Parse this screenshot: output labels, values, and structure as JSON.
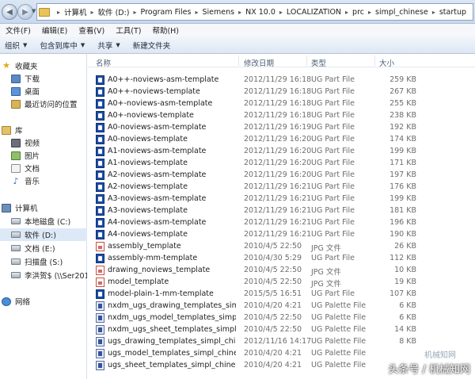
{
  "address": {
    "crumbs": [
      "计算机",
      "软件 (D:)",
      "Program Files",
      "Siemens",
      "NX 10.0",
      "LOCALIZATION",
      "prc",
      "simpl_chinese",
      "startup"
    ]
  },
  "menu": [
    "文件(F)",
    "编辑(E)",
    "查看(V)",
    "工具(T)",
    "帮助(H)"
  ],
  "commands": {
    "organize": "组织",
    "include": "包含到库中",
    "share": "共享",
    "new_folder": "新建文件夹"
  },
  "nav": {
    "favorites": "收藏夹",
    "downloads": "下载",
    "desktop": "桌面",
    "recent": "最近访问的位置",
    "libraries": "库",
    "videos": "视频",
    "pictures": "图片",
    "documents": "文档",
    "music": "音乐",
    "computer": "计算机",
    "drive_c": "本地磁盘 (C:)",
    "drive_d": "软件 (D:)",
    "drive_e": "文档 (E:)",
    "drive_s": "扫描盘 (S:)",
    "drive_net": "李洪贺$ (\\\\Ser2012",
    "network": "网络"
  },
  "columns": {
    "name": "名称",
    "date": "修改日期",
    "type": "类型",
    "size": "大小"
  },
  "files": [
    {
      "name": "A0++-noviews-asm-template",
      "date": "2012/11/29 16:18",
      "type": "UG Part File",
      "size": "259 KB",
      "icon": "prt"
    },
    {
      "name": "A0++-noviews-template",
      "date": "2012/11/29 16:18",
      "type": "UG Part File",
      "size": "267 KB",
      "icon": "prt"
    },
    {
      "name": "A0+-noviews-asm-template",
      "date": "2012/11/29 16:18",
      "type": "UG Part File",
      "size": "255 KB",
      "icon": "prt"
    },
    {
      "name": "A0+-noviews-template",
      "date": "2012/11/29 16:18",
      "type": "UG Part File",
      "size": "238 KB",
      "icon": "prt"
    },
    {
      "name": "A0-noviews-asm-template",
      "date": "2012/11/29 16:19",
      "type": "UG Part File",
      "size": "192 KB",
      "icon": "prt"
    },
    {
      "name": "A0-noviews-template",
      "date": "2012/11/29 16:20",
      "type": "UG Part File",
      "size": "174 KB",
      "icon": "prt"
    },
    {
      "name": "A1-noviews-asm-template",
      "date": "2012/11/29 16:20",
      "type": "UG Part File",
      "size": "199 KB",
      "icon": "prt"
    },
    {
      "name": "A1-noviews-template",
      "date": "2012/11/29 16:20",
      "type": "UG Part File",
      "size": "171 KB",
      "icon": "prt"
    },
    {
      "name": "A2-noviews-asm-template",
      "date": "2012/11/29 16:20",
      "type": "UG Part File",
      "size": "197 KB",
      "icon": "prt"
    },
    {
      "name": "A2-noviews-template",
      "date": "2012/11/29 16:21",
      "type": "UG Part File",
      "size": "176 KB",
      "icon": "prt"
    },
    {
      "name": "A3-noviews-asm-template",
      "date": "2012/11/29 16:21",
      "type": "UG Part File",
      "size": "199 KB",
      "icon": "prt"
    },
    {
      "name": "A3-noviews-template",
      "date": "2012/11/29 16:21",
      "type": "UG Part File",
      "size": "181 KB",
      "icon": "prt"
    },
    {
      "name": "A4-noviews-asm-template",
      "date": "2012/11/29 16:21",
      "type": "UG Part File",
      "size": "196 KB",
      "icon": "prt"
    },
    {
      "name": "A4-noviews-template",
      "date": "2012/11/29 16:21",
      "type": "UG Part File",
      "size": "190 KB",
      "icon": "prt"
    },
    {
      "name": "assembly_template",
      "date": "2010/4/5 22:50",
      "type": "JPG 文件",
      "size": "26 KB",
      "icon": "jpg"
    },
    {
      "name": "assembly-mm-template",
      "date": "2010/4/30 5:29",
      "type": "UG Part File",
      "size": "112 KB",
      "icon": "prt"
    },
    {
      "name": "drawing_noviews_template",
      "date": "2010/4/5 22:50",
      "type": "JPG 文件",
      "size": "10 KB",
      "icon": "jpg"
    },
    {
      "name": "model_template",
      "date": "2010/4/5 22:50",
      "type": "JPG 文件",
      "size": "19 KB",
      "icon": "jpg"
    },
    {
      "name": "model-plain-1-mm-template",
      "date": "2015/5/5 16:51",
      "type": "UG Part File",
      "size": "107 KB",
      "icon": "prt"
    },
    {
      "name": "nxdm_ugs_drawing_templates_simpl_...",
      "date": "2010/4/20 4:21",
      "type": "UG Palette File",
      "size": "6 KB",
      "icon": "pax"
    },
    {
      "name": "nxdm_ugs_model_templates_simpl_ch...",
      "date": "2010/4/5 22:50",
      "type": "UG Palette File",
      "size": "6 KB",
      "icon": "pax"
    },
    {
      "name": "nxdm_ugs_sheet_templates_simpl_chi...",
      "date": "2010/4/5 22:50",
      "type": "UG Palette File",
      "size": "14 KB",
      "icon": "pax"
    },
    {
      "name": "ugs_drawing_templates_simpl_chinese",
      "date": "2012/11/16 14:17",
      "type": "UG Palette File",
      "size": "8 KB",
      "icon": "pax"
    },
    {
      "name": "ugs_model_templates_simpl_chinese",
      "date": "2010/4/20 4:21",
      "type": "UG Palette File",
      "size": "",
      "icon": "pax"
    },
    {
      "name": "ugs_sheet_templates_simpl_chinese",
      "date": "2010/4/20 4:21",
      "type": "UG Palette File",
      "size": "",
      "icon": "pax"
    }
  ],
  "watermark": {
    "top": "机械知网",
    "bottom": "头条号 / 机械知网"
  }
}
